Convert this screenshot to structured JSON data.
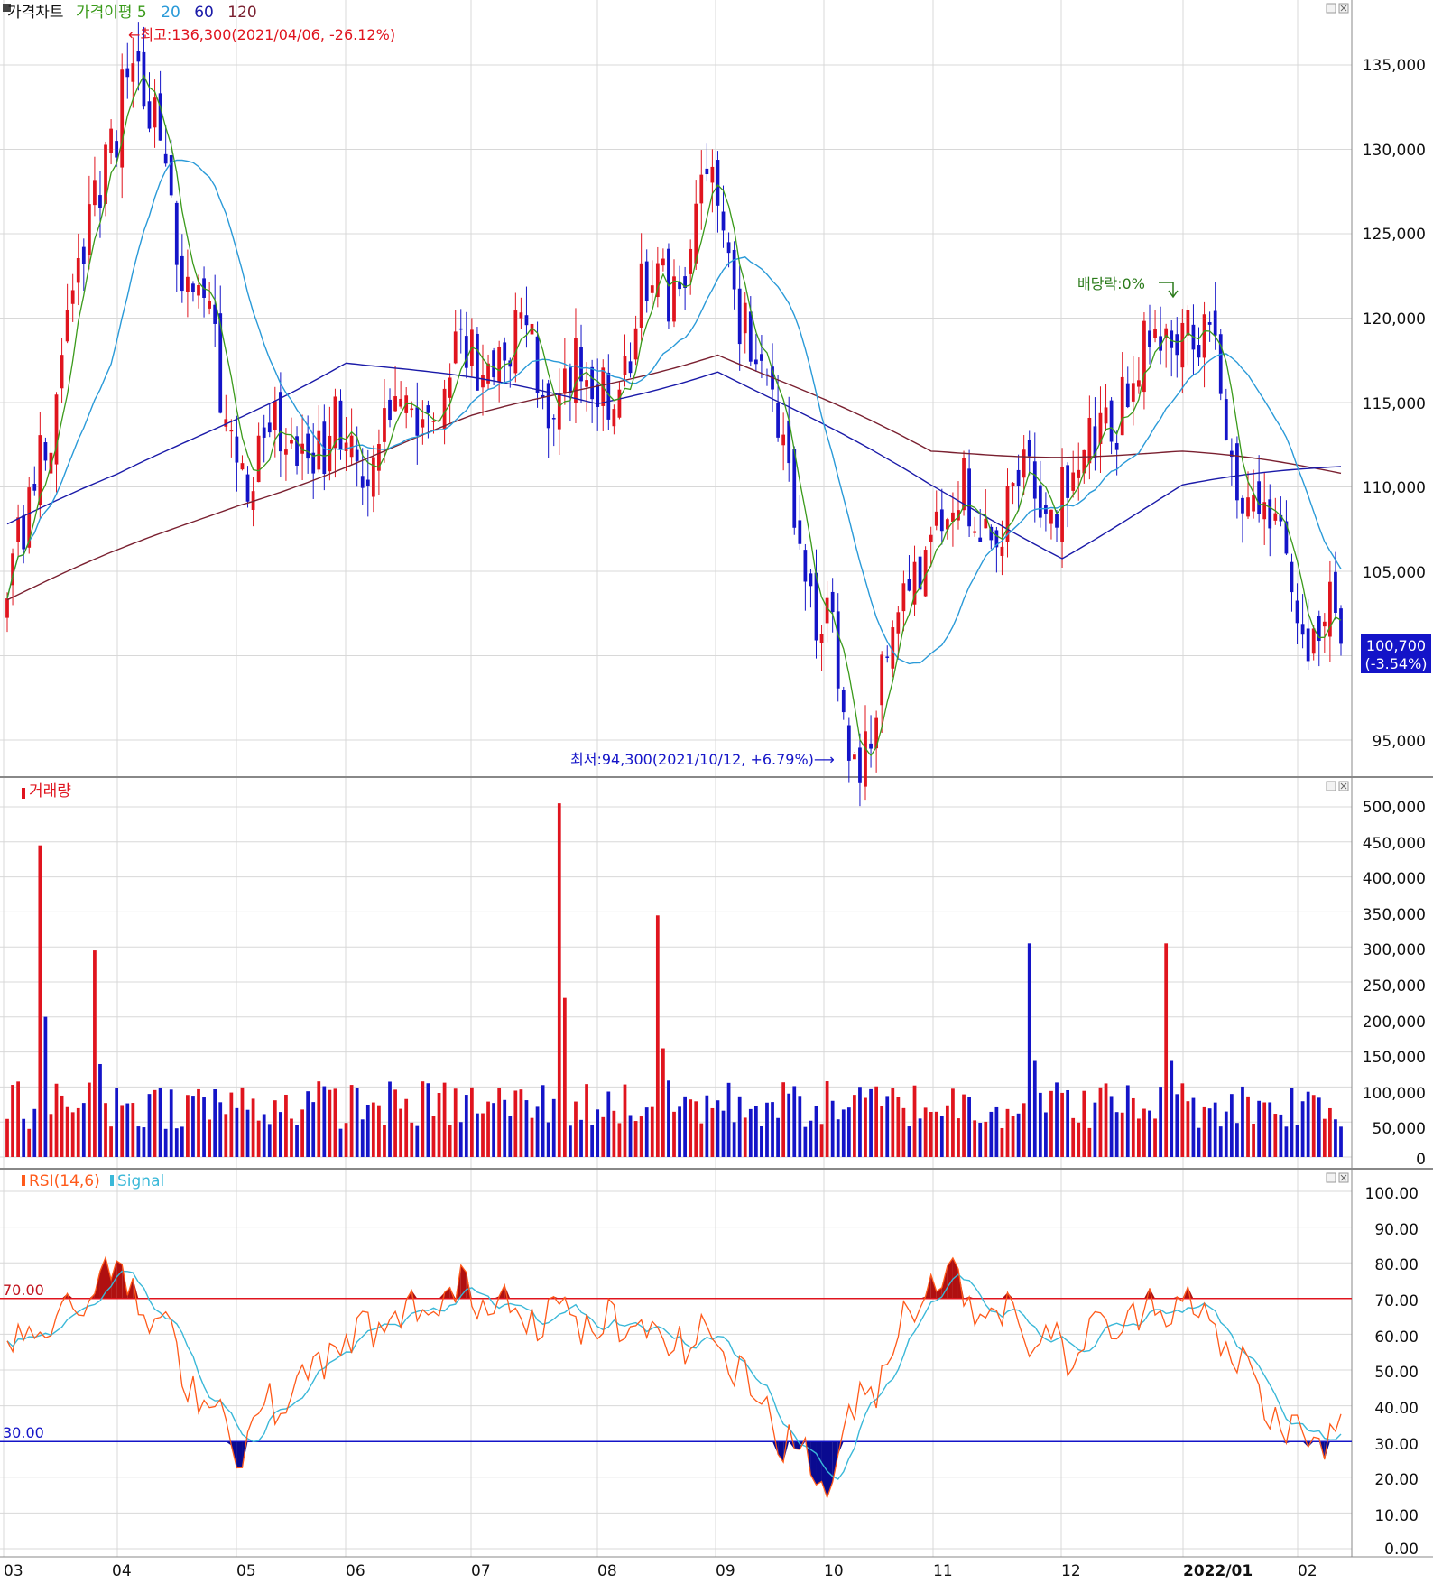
{
  "colors": {
    "up": "#e0141e",
    "down": "#1414c8",
    "ma5": "#3a9a1a",
    "ma20": "#2a9ad8",
    "ma60": "#1a1aa8",
    "ma120": "#7a2030",
    "rsi": "#ff5a1a",
    "signal": "#3ab8d8",
    "grid": "#d8d8d8",
    "panelBorder": "#888888"
  },
  "price_panel": {
    "title_main": "가격차트",
    "title_ma": "가격이평 5",
    "title_20": "20",
    "title_60": "60",
    "title_120": "120",
    "high_annotation": "←최고:136,300(2021/04/06, -26.12%)",
    "low_annotation": "최저:94,300(2021/10/12, +6.79%)⟶",
    "dividend_label": "배당락:0%",
    "current_price": "100,700",
    "current_change": "(-3.54%)",
    "y_ticks": [
      "135,000",
      "130,000",
      "125,000",
      "120,000",
      "115,000",
      "110,000",
      "105,000",
      "95,000"
    ]
  },
  "volume_panel": {
    "title": "거래량",
    "y_ticks": [
      "500,000",
      "450,000",
      "400,000",
      "350,000",
      "300,000",
      "250,000",
      "200,000",
      "150,000",
      "100,000",
      "50,000",
      "0"
    ]
  },
  "rsi_panel": {
    "title_rsi": "RSI(14,6)",
    "title_signal": "Signal",
    "level_70": "70.00",
    "level_30": "30.00",
    "y_ticks": [
      "100.00",
      "90.00",
      "80.00",
      "70.00",
      "60.00",
      "50.00",
      "40.00",
      "30.00",
      "20.00",
      "10.00",
      "0.00"
    ]
  },
  "x_axis": {
    "labels": [
      "03",
      "04",
      "05",
      "06",
      "07",
      "08",
      "09",
      "10",
      "11",
      "12",
      "2022/01",
      "02"
    ]
  },
  "chart_data": [
    {
      "type": "candlestick",
      "panel": "price",
      "ylim": [
        93000,
        139000
      ],
      "series_names": [
        "5",
        "20",
        "60",
        "120"
      ],
      "anchors": [
        {
          "month": "03",
          "price": 102000
        },
        {
          "month": "04",
          "price": 133000
        },
        {
          "date": "2021/04/06",
          "price": 136300
        },
        {
          "month": "05",
          "price": 112000
        },
        {
          "month": "06",
          "price": 112000
        },
        {
          "month": "07",
          "price": 118000
        },
        {
          "month": "08",
          "price": 116000
        },
        {
          "month": "09",
          "price": 127000
        },
        {
          "month": "10",
          "price": 102000
        },
        {
          "date": "2021/10/12",
          "price": 94300
        },
        {
          "month": "11",
          "price": 108000
        },
        {
          "month": "12",
          "price": 110000
        },
        {
          "month": "2022/01",
          "price": 121000
        },
        {
          "month": "02",
          "price": 103000
        },
        {
          "label": "last",
          "price": 100700
        }
      ],
      "ma_levels": {
        "60": {
          "start": 107800,
          "apr": 110500,
          "jun": 117500,
          "aug": 115000,
          "sep": 117000,
          "nov": 110000,
          "dec": 106000,
          "jan": 110000,
          "end": 111200
        },
        "120": {
          "start": 103300,
          "may": 109000,
          "jul": 114000,
          "sep": 118000,
          "nov": 112000,
          "jan": 112000,
          "end": 110800
        }
      }
    },
    {
      "type": "bar",
      "panel": "volume",
      "ylim": [
        0,
        520000
      ],
      "notable_peaks": [
        {
          "month": "03",
          "value": 445000
        },
        {
          "month": "04",
          "value": 295000
        },
        {
          "month": "07",
          "value": 505000
        },
        {
          "month": "08",
          "value": 345000
        },
        {
          "month": "11",
          "value": 305000
        },
        {
          "month": "2022/01",
          "value": 305000
        }
      ]
    },
    {
      "type": "line",
      "panel": "rsi",
      "ylim": [
        0,
        100
      ],
      "levels": [
        70,
        30
      ],
      "series": [
        {
          "name": "RSI(14,6)",
          "key_points": [
            {
              "month": "03",
              "value": 55
            },
            {
              "month": "04",
              "value": 78
            },
            {
              "month": "05",
              "value": 30
            },
            {
              "month": "06",
              "value": 58
            },
            {
              "month": "07",
              "value": 72
            },
            {
              "month": "08",
              "value": 62
            },
            {
              "month": "09",
              "value": 58
            },
            {
              "month": "10",
              "value": 18
            },
            {
              "month": "11",
              "value": 78
            },
            {
              "month": "12",
              "value": 55
            },
            {
              "month": "2022/01",
              "value": 72
            },
            {
              "month": "02",
              "value": 30
            }
          ]
        },
        {
          "name": "Signal"
        }
      ]
    }
  ]
}
